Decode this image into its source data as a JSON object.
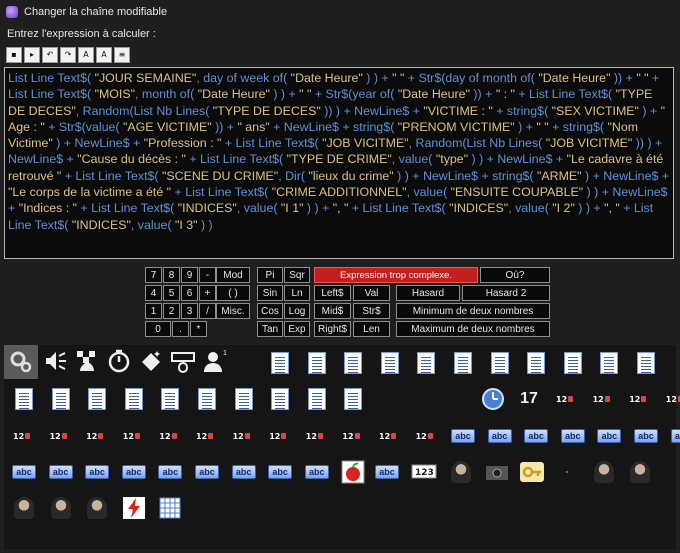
{
  "window": {
    "title": "Changer la chaîne modifiable"
  },
  "prompt": "Entrez l'expression à calculer :",
  "toolbar": {
    "items": [
      {
        "icon": "new-icon",
        "glyph": "▪"
      },
      {
        "icon": "step-icon",
        "glyph": "▸"
      },
      {
        "icon": "undo-icon",
        "glyph": "↶"
      },
      {
        "icon": "redo-icon",
        "glyph": "↷"
      },
      {
        "icon": "font-up-icon",
        "glyph": "A"
      },
      {
        "icon": "font-down-icon",
        "glyph": "A"
      },
      {
        "icon": "syntax-icon",
        "glyph": "≡"
      }
    ]
  },
  "expression": [
    {
      "t": "f",
      "v": "List Line Text$( "
    },
    {
      "t": "s",
      "v": "\"JOUR SEMAINE\""
    },
    {
      "t": "f",
      "v": ", day of week of( "
    },
    {
      "t": "s",
      "v": "\"Date Heure\""
    },
    {
      "t": "f",
      "v": " ) ) + "
    },
    {
      "t": "s",
      "v": "\" \""
    },
    {
      "t": "f",
      "v": " + Str$(day of month of( "
    },
    {
      "t": "s",
      "v": "\"Date Heure\""
    },
    {
      "t": "f",
      "v": " )) + "
    },
    {
      "t": "s",
      "v": "\" \""
    },
    {
      "t": "f",
      "v": " + List Line Text$( "
    },
    {
      "t": "s",
      "v": "\"MOIS\""
    },
    {
      "t": "f",
      "v": ", month of( "
    },
    {
      "t": "s",
      "v": "\"Date Heure\""
    },
    {
      "t": "f",
      "v": " ) ) + "
    },
    {
      "t": "s",
      "v": "\" \""
    },
    {
      "t": "f",
      "v": " + Str$(year of( "
    },
    {
      "t": "s",
      "v": "\"Date Heure\""
    },
    {
      "t": "f",
      "v": " )) + "
    },
    {
      "t": "s",
      "v": "\" : \""
    },
    {
      "t": "f",
      "v": " + List Line Text$( "
    },
    {
      "t": "s",
      "v": "\"TYPE DE DECES\""
    },
    {
      "t": "f",
      "v": ", Random(List Nb Lines( "
    },
    {
      "t": "s",
      "v": "\"TYPE DE DECES\""
    },
    {
      "t": "f",
      "v": " )) ) + NewLine$ + "
    },
    {
      "t": "s",
      "v": "\"VICTIME : \""
    },
    {
      "t": "f",
      "v": " + string$( "
    },
    {
      "t": "s",
      "v": "\"SEX VICTIME\""
    },
    {
      "t": "f",
      "v": " ) + "
    },
    {
      "t": "s",
      "v": "\" Age : \""
    },
    {
      "t": "f",
      "v": " + Str$(value( "
    },
    {
      "t": "s",
      "v": "\"AGE VICTIME\""
    },
    {
      "t": "f",
      "v": " )) + "
    },
    {
      "t": "s",
      "v": "\" ans\""
    },
    {
      "t": "f",
      "v": " + NewLine$ + string$( "
    },
    {
      "t": "s",
      "v": "\"PRENOM VICTIME\""
    },
    {
      "t": "f",
      "v": " ) + "
    },
    {
      "t": "s",
      "v": "\" \""
    },
    {
      "t": "f",
      "v": " + string$( "
    },
    {
      "t": "s",
      "v": "\"Nom Victime\""
    },
    {
      "t": "f",
      "v": " ) + NewLine$ + "
    },
    {
      "t": "s",
      "v": "\"Profession : \""
    },
    {
      "t": "f",
      "v": " + List Line Text$( "
    },
    {
      "t": "s",
      "v": "\"JOB VICITME\""
    },
    {
      "t": "f",
      "v": ", Random(List Nb Lines( "
    },
    {
      "t": "s",
      "v": "\"JOB VICITME\""
    },
    {
      "t": "f",
      "v": " )) ) + NewLine$ + "
    },
    {
      "t": "s",
      "v": "\"Cause du décès : \""
    },
    {
      "t": "f",
      "v": " + List Line Text$( "
    },
    {
      "t": "s",
      "v": "\"TYPE DE CRIME\""
    },
    {
      "t": "f",
      "v": ", value( "
    },
    {
      "t": "s",
      "v": "\"type\""
    },
    {
      "t": "f",
      "v": " ) ) + NewLine$ + "
    },
    {
      "t": "s",
      "v": "\"Le cadavre à été retrouvé \""
    },
    {
      "t": "f",
      "v": " + List Line Text$( "
    },
    {
      "t": "s",
      "v": "\"SCENE DU CRIME\""
    },
    {
      "t": "f",
      "v": ", Dir( "
    },
    {
      "t": "s",
      "v": "\"lieux du crime\""
    },
    {
      "t": "f",
      "v": " ) ) + NewLine$ + string$( "
    },
    {
      "t": "s",
      "v": "\"ARME\""
    },
    {
      "t": "f",
      "v": " ) + NewLine$ + "
    },
    {
      "t": "s",
      "v": "\"Le corps de la victime a été \""
    },
    {
      "t": "f",
      "v": " + List Line Text$( "
    },
    {
      "t": "s",
      "v": "\"CRIME ADDITIONNEL\""
    },
    {
      "t": "f",
      "v": ", value( "
    },
    {
      "t": "s",
      "v": "\"ENSUITE COUPABLE\""
    },
    {
      "t": "f",
      "v": " ) ) + NewLine$ + "
    },
    {
      "t": "s",
      "v": "\"Indices : \""
    },
    {
      "t": "f",
      "v": " + List Line Text$( "
    },
    {
      "t": "s",
      "v": "\"INDICES\""
    },
    {
      "t": "f",
      "v": ", value( "
    },
    {
      "t": "s",
      "v": "\"I 1\""
    },
    {
      "t": "f",
      "v": " ) ) + "
    },
    {
      "t": "s",
      "v": "\", \""
    },
    {
      "t": "f",
      "v": " + List Line Text$( "
    },
    {
      "t": "s",
      "v": "\"INDICES\""
    },
    {
      "t": "f",
      "v": ", value( "
    },
    {
      "t": "s",
      "v": "\"I 2\""
    },
    {
      "t": "f",
      "v": " ) ) + "
    },
    {
      "t": "s",
      "v": "\", \""
    },
    {
      "t": "f",
      "v": " + List Line Text$( "
    },
    {
      "t": "s",
      "v": "\"INDICES\""
    },
    {
      "t": "f",
      "v": ", value( "
    },
    {
      "t": "s",
      "v": "\"I 3\""
    },
    {
      "t": "f",
      "v": " ) )"
    }
  ],
  "keypad": {
    "digits": [
      "7",
      "8",
      "9",
      "-",
      "4",
      "5",
      "6",
      "+",
      "1",
      "2",
      "3",
      "/",
      "0",
      ".",
      "*"
    ],
    "mod": "Mod",
    "parens": "( )",
    "misc": "Misc.",
    "funcs": [
      "Pi",
      "Sqr",
      "Sin",
      "Ln",
      "Cos",
      "Log",
      "Tan",
      "Exp"
    ],
    "strfuncs": [
      "Left$",
      "Val",
      "Mid$",
      "Str$",
      "Right$",
      "Len"
    ],
    "error": "Expression trop complexe.",
    "where": "Où?",
    "hasard": "Hasard",
    "hasard2": "Hasard 2",
    "min": "Minimum de deux nombres",
    "max": "Maximum de deux nombres"
  },
  "objects": {
    "top": [
      {
        "name": "system-icon"
      },
      {
        "name": "sound-icon"
      },
      {
        "name": "storyboard-icon"
      },
      {
        "name": "timer-icon"
      },
      {
        "name": "create-icon"
      },
      {
        "name": "keyboard-mouse-icon"
      },
      {
        "name": "player-icon",
        "badge": "1"
      }
    ],
    "clock_value": "17",
    "row_counts": {
      "docs1": 11,
      "docs2": 10,
      "nums": 16
    }
  }
}
